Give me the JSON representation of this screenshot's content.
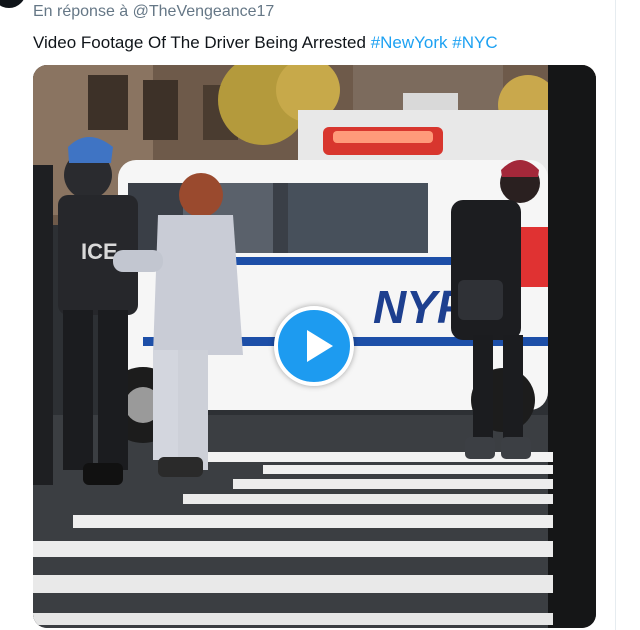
{
  "tweet": {
    "reply_line": "En réponse à @TheVengeance17",
    "text_main": "Video Footage Of The Driver Being Arrested",
    "hashtags": [
      "#NewYork",
      "#NYC"
    ]
  },
  "video": {
    "play_icon": "play-icon",
    "frame_text": {
      "car_marking": "NYP",
      "vest_text": "ICE"
    }
  },
  "colors": {
    "hashtag": "#1da1f2",
    "play_button": "#1d9bf0"
  }
}
